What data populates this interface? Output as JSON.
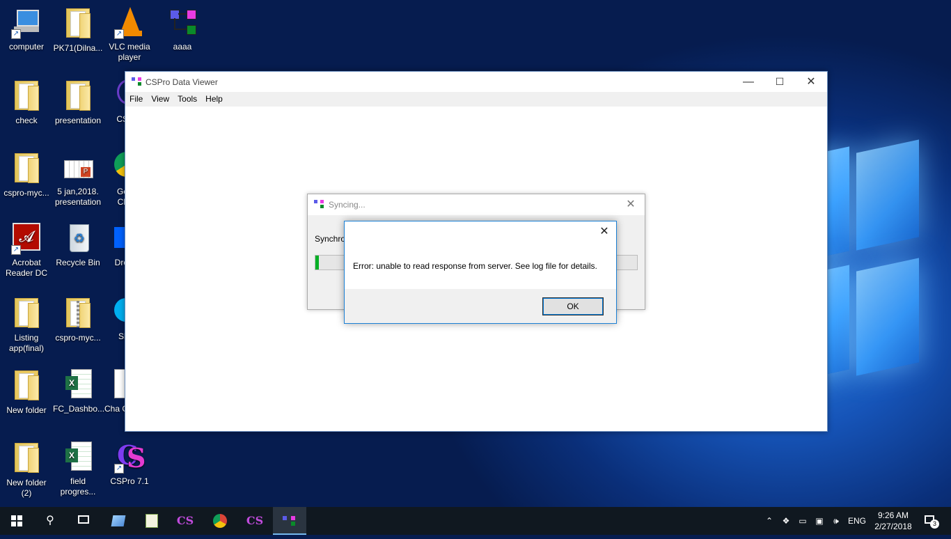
{
  "desktop": {
    "icons": [
      {
        "label": "computer"
      },
      {
        "label": "PK71(Dilna..."
      },
      {
        "label": "VLC media player"
      },
      {
        "label": "aaaa"
      },
      {
        "label": "check"
      },
      {
        "label": "presentation"
      },
      {
        "label": "CS"
      },
      {
        "label": "cspro-myc..."
      },
      {
        "label": "5 jan,2018. presentation"
      },
      {
        "label": "Go Ch"
      },
      {
        "label": "Acrobat Reader DC"
      },
      {
        "label": "Recycle Bin"
      },
      {
        "label": "Dro"
      },
      {
        "label": "Listing app(final)"
      },
      {
        "label": "cspro-myc..."
      },
      {
        "label": "Sk"
      },
      {
        "label": "New folder"
      },
      {
        "label": "FC_Dashbo..."
      },
      {
        "label": "Cha C"
      },
      {
        "label": "New folder (2)"
      },
      {
        "label": "field progres..."
      },
      {
        "label": "CSPro 7.1"
      }
    ]
  },
  "main_window": {
    "title": "CSPro Data Viewer",
    "menu": [
      "File",
      "View",
      "Tools",
      "Help"
    ],
    "controls": {
      "minimize": "—",
      "maximize": "☐",
      "close": "✕"
    }
  },
  "sync_dialog": {
    "title": "Syncing...",
    "label": "Synchro",
    "progress_fraction": 0.01,
    "close": "✕"
  },
  "error_dialog": {
    "message": "Error: unable to read response from server. See log file for details.",
    "ok_label": "OK",
    "close": "✕"
  },
  "taskbar": {
    "tray": {
      "language": "ENG"
    },
    "clock": {
      "time": "9:26 AM",
      "date": "2/27/2018"
    },
    "notification_count": "3"
  },
  "colors": {
    "progress": "#06b025",
    "accent": "#0078d7"
  }
}
